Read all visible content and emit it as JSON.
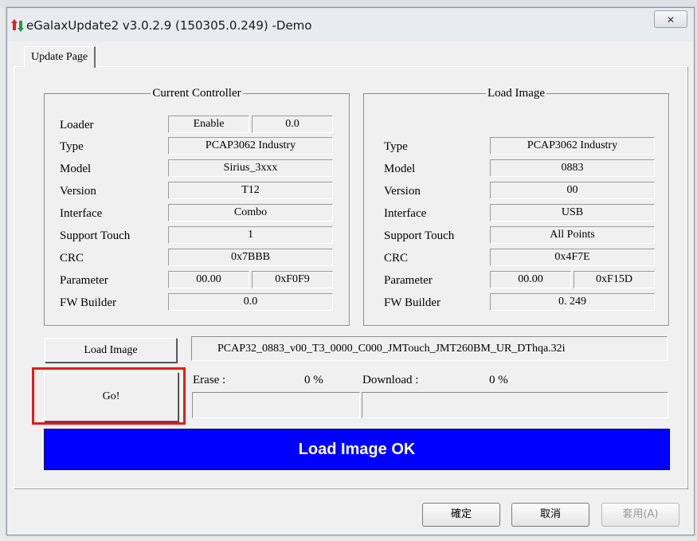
{
  "window": {
    "title": "eGalaxUpdate2 v3.0.2.9 (150305.0.249) -Demo",
    "close_glyph": "✕"
  },
  "tabs": [
    {
      "label": "Update Page"
    }
  ],
  "current_controller": {
    "title": "Current Controller",
    "rows": {
      "loader": {
        "label": "Loader",
        "values": [
          "Enable",
          "0.0"
        ]
      },
      "type": {
        "label": "Type",
        "value": "PCAP3062 Industry"
      },
      "model": {
        "label": "Model",
        "value": "Sirius_3xxx"
      },
      "version": {
        "label": "Version",
        "value": "T12"
      },
      "interface": {
        "label": "Interface",
        "value": "Combo"
      },
      "support_touch": {
        "label": "Support Touch",
        "value": "1"
      },
      "crc": {
        "label": "CRC",
        "value": "0x7BBB"
      },
      "parameter": {
        "label": "Parameter",
        "values": [
          "00.00",
          "0xF0F9"
        ]
      },
      "fw_builder": {
        "label": "FW Builder",
        "value": "0.0"
      }
    }
  },
  "load_image_group": {
    "title": "Load Image",
    "rows": {
      "type": {
        "label": "Type",
        "value": "PCAP3062 Industry"
      },
      "model": {
        "label": "Model",
        "value": "0883"
      },
      "version": {
        "label": "Version",
        "value": "00"
      },
      "interface": {
        "label": "Interface",
        "value": "USB"
      },
      "support_touch": {
        "label": "Support Touch",
        "value": "All Points"
      },
      "crc": {
        "label": "CRC",
        "value": "0x4F7E"
      },
      "parameter": {
        "label": "Parameter",
        "values": [
          "00.00",
          "0xF15D"
        ]
      },
      "fw_builder": {
        "label": "FW Builder",
        "value": "0. 249"
      }
    }
  },
  "actions": {
    "load_image_label": "Load Image",
    "image_path": "PCAP32_0883_v00_T3_0000_C000_JMTouch_JMT260BM_UR_DThqa.32i",
    "go_label": "Go!"
  },
  "progress": {
    "erase_label": "Erase :",
    "erase_value": "0 %",
    "erase_fraction": 0,
    "download_label": "Download :",
    "download_value": "0 %",
    "download_fraction": 0
  },
  "status": {
    "message": "Load Image OK",
    "color": "#0000ff"
  },
  "dialog_buttons": {
    "ok": "確定",
    "cancel": "取消",
    "apply": "套用(A)"
  },
  "colors": {
    "highlight": "#e41b1b",
    "app_icon_red": "#d8262b",
    "app_icon_green": "#1f9e3c"
  }
}
